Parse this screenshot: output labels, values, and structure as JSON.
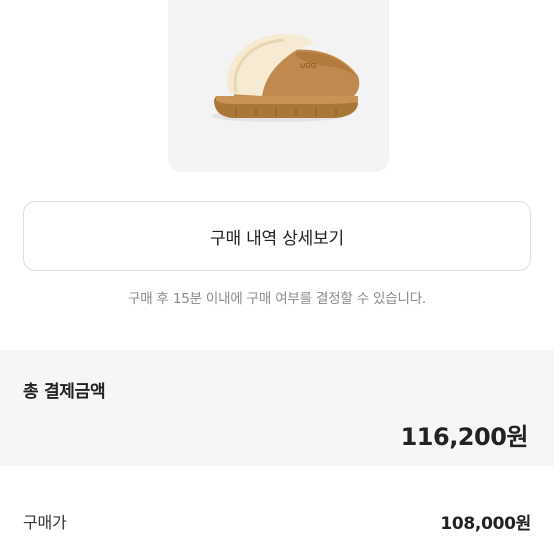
{
  "product": {
    "image_icon": "slipper-product-image"
  },
  "detail_button": {
    "label": "구매 내역 상세보기"
  },
  "notice": {
    "text": "구매 후 15분 이내에 구매 여부를 결정할 수 있습니다."
  },
  "total": {
    "label": "총 결제금액",
    "value": "116,200원"
  },
  "breakdown": [
    {
      "label": "구매가",
      "value": "108,000원"
    }
  ],
  "colors": {
    "background": "#ffffff",
    "section_bg": "#f6f6f6",
    "border": "#dedede",
    "muted_text": "#8a8a8a"
  }
}
